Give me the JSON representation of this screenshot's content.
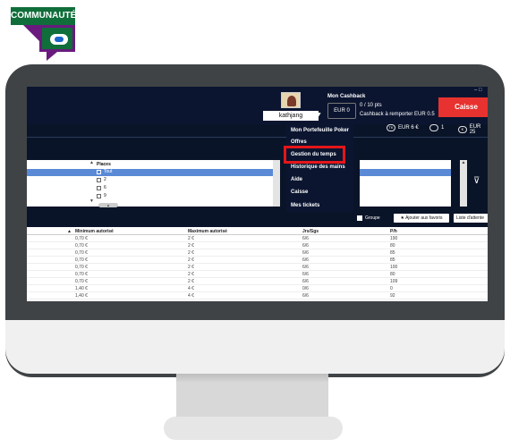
{
  "logo": {
    "text": "COMMUNAUTÉ"
  },
  "header": {
    "username": "kathjang",
    "cashback_title": "Mon Cashback",
    "eur_box": "EUR 0",
    "points": "0 / 10 pts",
    "cashback_sub": "Cashback à remporter EUR 0.5",
    "caisse": "Caisse",
    "window_controls": "– □"
  },
  "stats": [
    {
      "icon": "ticket-icon",
      "icon_text": "TK",
      "value": "EUR 6 €"
    },
    {
      "icon": "voucher-icon",
      "icon_text": "",
      "value": "1"
    },
    {
      "icon": "euro-icon",
      "icon_text": "€",
      "value": "EUR 25"
    }
  ],
  "menu": {
    "items": [
      "Mon Portefeuille Poker",
      "Offres",
      "Gestion du temps",
      "Historique des mains",
      "Aide",
      "Caisse",
      "Mes tickets"
    ]
  },
  "places": {
    "title": "Places",
    "options": [
      {
        "label": "Tout",
        "checked": true
      },
      {
        "label": "2",
        "checked": false
      },
      {
        "label": "6",
        "checked": false
      },
      {
        "label": "9",
        "checked": false
      }
    ]
  },
  "toolbar": {
    "groupe": "Groupe",
    "fav": "Ajouter aux favoris",
    "wait": "Liste d'attente"
  },
  "table": {
    "headers": [
      "Minimum autorisé",
      "Maximum autorisé",
      "Jrs/Sgs",
      "P/h"
    ],
    "rows": [
      [
        "0,70 €",
        "2 €",
        "6/6",
        "190"
      ],
      [
        "0,70 €",
        "2 €",
        "6/6",
        "80"
      ],
      [
        "0,70 €",
        "2 €",
        "6/6",
        "85"
      ],
      [
        "0,70 €",
        "2 €",
        "6/6",
        "85"
      ],
      [
        "0,70 €",
        "2 €",
        "6/6",
        "100"
      ],
      [
        "0,70 €",
        "2 €",
        "6/6",
        "80"
      ],
      [
        "0,70 €",
        "2 €",
        "6/6",
        "109"
      ],
      [
        "1,40 €",
        "4 €",
        "0/6",
        "0"
      ],
      [
        "1,40 €",
        "4 €",
        "6/6",
        "92"
      ]
    ]
  },
  "colors": {
    "caisse": "#e8322f",
    "highlight": "#e5161a",
    "selection": "#5a8ad6",
    "logo_green": "#0f6e3a",
    "logo_purple": "#6a1a7e"
  }
}
